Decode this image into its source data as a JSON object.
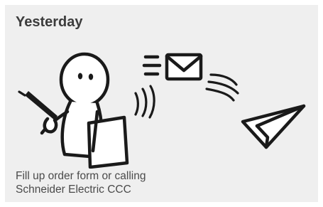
{
  "card": {
    "title": "Yesterday",
    "caption_line1": "Fill up order form or calling",
    "caption_line2": "Schneider Electric CCC"
  },
  "illustration": {
    "icons": [
      "person-writing-icon",
      "envelope-icon",
      "paper-plane-icon"
    ]
  }
}
